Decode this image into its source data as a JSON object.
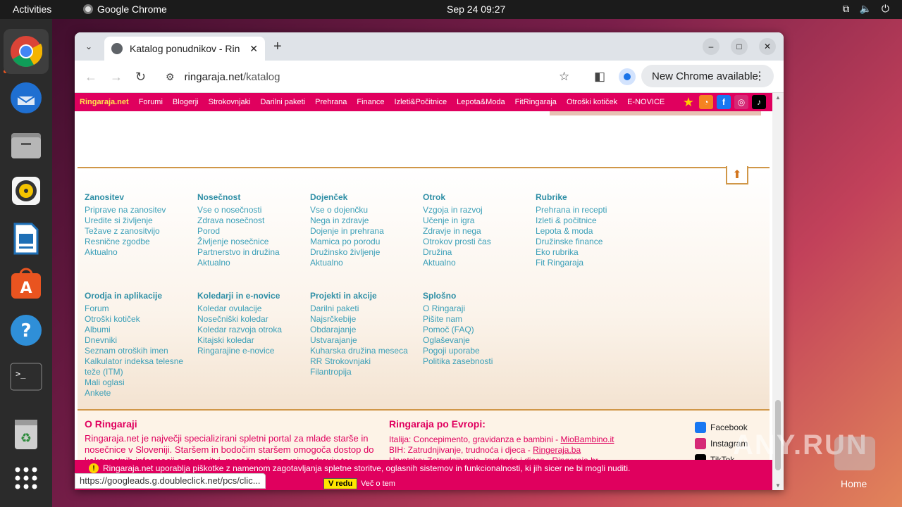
{
  "topbar": {
    "activities": "Activities",
    "app_name": "Google Chrome",
    "clock": "Sep 24  09:27"
  },
  "dock": {
    "items": [
      "chrome-icon",
      "thunderbird-icon",
      "files-icon",
      "rhythmbox-icon",
      "writer-icon",
      "app-center-icon",
      "help-icon",
      "terminal-icon",
      "trash-icon",
      "apps-grid-icon"
    ]
  },
  "browser": {
    "tab_title": "Katalog ponudnikov - Rin",
    "url_host": "ringaraja.net",
    "url_path": "/katalog",
    "update_label": "New Chrome available"
  },
  "site_nav": {
    "brand": "Ringaraja.net",
    "links": [
      "Forumi",
      "Blogerji",
      "Strokovnjaki",
      "Darilni paketi",
      "Prehrana",
      "Finance",
      "Izleti&Počitnice",
      "Lepota&Moda",
      "FitRingaraja",
      "Otroški kotiček",
      "E-NOVICE"
    ]
  },
  "footer": {
    "columns_row1": [
      {
        "heading": "Zanositev",
        "links": [
          "Priprave na zanositev",
          "Uredite si življenje",
          "Težave z zanositvijo",
          "Resnične zgodbe",
          "Aktualno"
        ]
      },
      {
        "heading": "Nosečnost",
        "links": [
          "Vse o nosečnosti",
          "Zdrava nosečnost",
          "Porod",
          "Življenje nosečnice",
          "Partnerstvo in družina",
          "Aktualno"
        ]
      },
      {
        "heading": "Dojenček",
        "links": [
          "Vse o dojenčku",
          "Nega in zdravje",
          "Dojenje in prehrana",
          "Mamica po porodu",
          "Družinsko življenje",
          "Aktualno"
        ]
      },
      {
        "heading": "Otrok",
        "links": [
          "Vzgoja in razvoj",
          "Učenje in igra",
          "Zdravje in nega",
          "Otrokov prosti čas",
          "Družina",
          "Aktualno"
        ]
      },
      {
        "heading": "Rubrike",
        "links": [
          "Prehrana in recepti",
          "Izleti & počitnice",
          "Lepota & moda",
          "Družinske finance",
          "Eko rubrika",
          "Fit Ringaraja"
        ]
      }
    ],
    "columns_row2": [
      {
        "heading": "Orodja in aplikacije",
        "links": [
          "Forum",
          "Otroški kotiček",
          "Albumi",
          "Dnevniki",
          "Seznam otroških imen",
          "Kalkulator indeksa telesne",
          "teže (ITM)",
          "Mali oglasi",
          "Ankete"
        ]
      },
      {
        "heading": "Koledarji in e-novice",
        "links": [
          "Koledar ovulacije",
          "Nosečniški koledar",
          "Koledar razvoja otroka",
          "Kitajski koledar",
          "Ringarajine e-novice"
        ]
      },
      {
        "heading": "Projekti in akcije",
        "links": [
          "Darilni paketi",
          "Najsrčkebije",
          "Obdarajanje",
          "Ustvarajanje",
          "Kuharska družina meseca",
          "RR Strokovnjaki",
          "Filantropija"
        ]
      },
      {
        "heading": "Splošno",
        "links": [
          "O Ringaraji",
          "Pišite nam",
          "Pomoč (FAQ)",
          "Oglaševanje",
          "Pogoji uporabe",
          "Politika zasebnosti"
        ]
      }
    ]
  },
  "about": {
    "heading": "O Ringaraji",
    "text_lines": [
      "Ringaraja.net je največji specializirani spletni portal za mlade starše in",
      "nosečnice v Sloveniji. Staršem in bodočim staršem omogoča dostop do",
      "kakovostnih informacij o zanositvi, nosečnosti, razvoju, zdravju ter"
    ],
    "europe_heading": "Ringaraja po Evropi:",
    "europe": [
      {
        "text": "Italija: Concepimento, gravidanza e bambini - ",
        "link": "MioBambino.it"
      },
      {
        "text": "BIH: Zatrudnjivanje, trudnoća i djeca - ",
        "link": "Ringeraja.ba"
      },
      {
        "text": "Hrvatska: Zatrudnjivanje, trudnoća i djeca - ",
        "link": "Ringeraja.hr"
      }
    ],
    "social": [
      "Facebook",
      "Instagram",
      "TikTok"
    ]
  },
  "cookie": {
    "message": "Ringaraja.net uporablja piškotke z namenom zagotavljanja spletne storitve, oglasnih sistemov in funkcionalnosti, ki jih sicer ne bi mogli nuditi.",
    "accept": "V redu",
    "more": "Več o tem"
  },
  "status_link": "https://googleads.g.doubleclick.net/pcs/clic...",
  "watermark": "ANY.RUN",
  "home_label": "Home"
}
